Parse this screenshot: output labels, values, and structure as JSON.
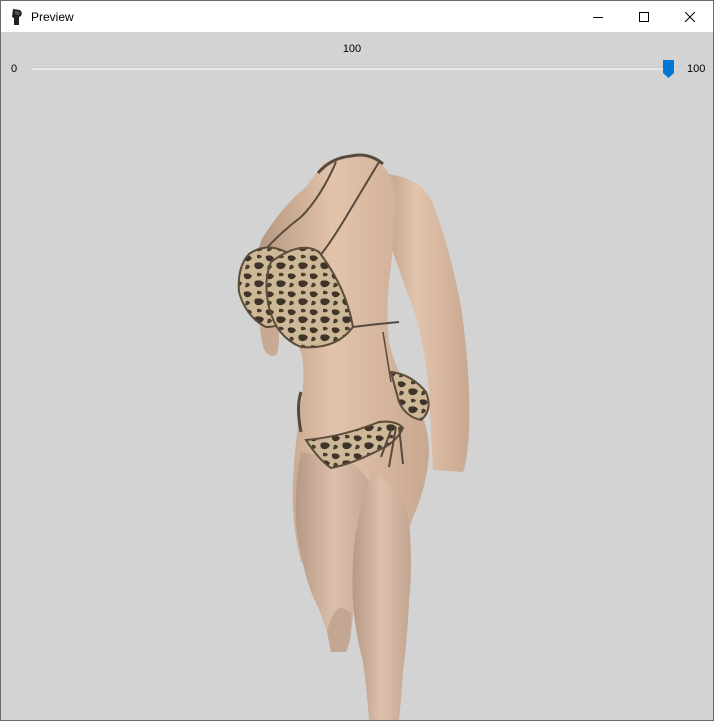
{
  "window": {
    "title": "Preview",
    "icon": "app-icon",
    "controls": [
      "minimize-icon",
      "maximize-icon",
      "close-icon"
    ]
  },
  "slider": {
    "value_label": "100",
    "min_label": "0",
    "max_label": "100",
    "value": 100,
    "min": 0,
    "max": 100,
    "accent_color": "#0078d7"
  },
  "viewport": {
    "background_color": "#d3d3d3",
    "content": "3d-model-preview"
  }
}
